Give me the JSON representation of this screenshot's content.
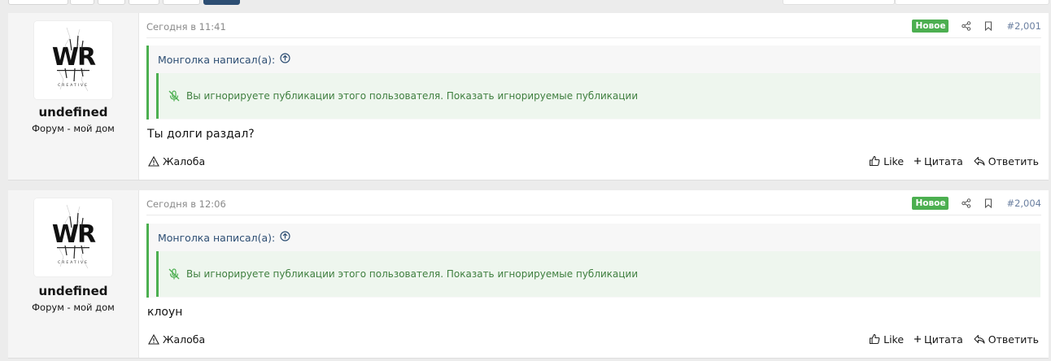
{
  "toolbar": {
    "buttons": [
      "",
      "",
      "",
      "",
      ""
    ],
    "primary_button": ""
  },
  "posts": [
    {
      "username": "undefined",
      "user_title": "Форум - мой дом",
      "date": "Сегодня в 11:41",
      "badge": "Новое",
      "post_number": "#2,001",
      "quote_author": "Монголка написал(а):",
      "ignored_notice": "Вы игнорируете публикации этого пользователя. Показать игнорируемые публикации",
      "text": "Ты долги раздал?",
      "report_label": "Жалоба",
      "like_label": "Like",
      "quote_label": "Цитата",
      "reply_label": "Ответить"
    },
    {
      "username": "undefined",
      "user_title": "Форум - мой дом",
      "date": "Сегодня в 12:06",
      "badge": "Новое",
      "post_number": "#2,004",
      "quote_author": "Монголка написал(а):",
      "ignored_notice": "Вы игнорируете публикации этого пользователя. Показать игнорируемые публикации",
      "text": "клоун",
      "report_label": "Жалоба",
      "like_label": "Like",
      "quote_label": "Цитата",
      "reply_label": "Ответить"
    }
  ],
  "icons": {
    "share": "share-icon",
    "bookmark": "bookmark-icon",
    "up_arrow": "arrow-up-circle-icon",
    "mute": "microphone-off-icon",
    "report": "warning-icon",
    "like": "thumbs-up-icon",
    "quote": "plus-icon",
    "reply": "reply-icon"
  },
  "colors": {
    "accent": "#2d4e73",
    "new_badge": "#4caf50",
    "ignored_text": "#3f7f3f",
    "page_bg": "#ececec"
  }
}
